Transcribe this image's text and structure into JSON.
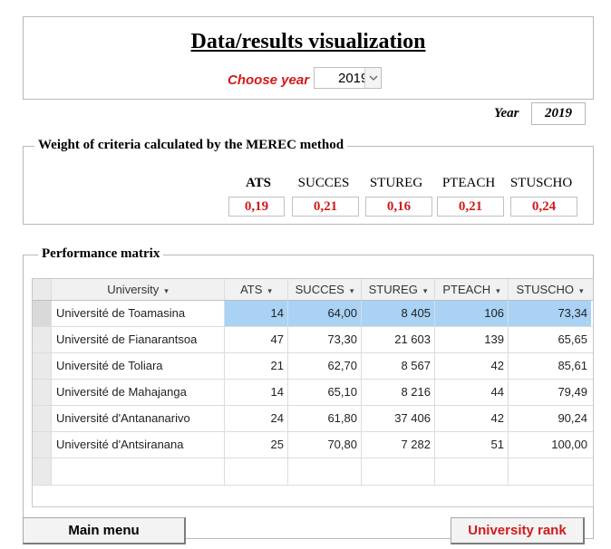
{
  "header": {
    "title": "Data/results visualization",
    "choose_year_label": "Choose year",
    "selected_year": "2019"
  },
  "year_display": {
    "label": "Year",
    "value": "2019"
  },
  "weights": {
    "title": "Weight of criteria calculated by the MEREC method",
    "criteria": [
      {
        "name": "ATS",
        "value": "0,19"
      },
      {
        "name": "SUCCES",
        "value": "0,21"
      },
      {
        "name": "STUREG",
        "value": "0,16"
      },
      {
        "name": "PTEACH",
        "value": "0,21"
      },
      {
        "name": "STUSCHO",
        "value": "0,24"
      }
    ]
  },
  "performance": {
    "title": "Performance matrix",
    "columns": [
      "University",
      "ATS",
      "SUCCES",
      "STUREG",
      "PTEACH",
      "STUSCHO"
    ],
    "rows": [
      [
        "Université de Toamasina",
        "14",
        "64,00",
        "8 405",
        "106",
        "73,34"
      ],
      [
        "Université de Fianarantsoa",
        "47",
        "73,30",
        "21 603",
        "139",
        "65,65"
      ],
      [
        "Université de Toliara",
        "21",
        "62,70",
        "8 567",
        "42",
        "85,61"
      ],
      [
        "Université de Mahajanga",
        "14",
        "65,10",
        "8 216",
        "44",
        "79,49"
      ],
      [
        "Université d'Antananarivo",
        "24",
        "61,80",
        "37 406",
        "42",
        "90,24"
      ],
      [
        "Université d'Antsiranana",
        "25",
        "70,80",
        "7 282",
        "51",
        "100,00"
      ]
    ],
    "selected_row": 0
  },
  "buttons": {
    "main_menu": "Main menu",
    "university_rank": "University rank"
  },
  "colors": {
    "accent_red": "#d11a1a",
    "selection_blue": "#a9d2f5"
  },
  "icons": {
    "dropdown": "chevron-down-icon",
    "sort": "sort-arrow-icon"
  }
}
